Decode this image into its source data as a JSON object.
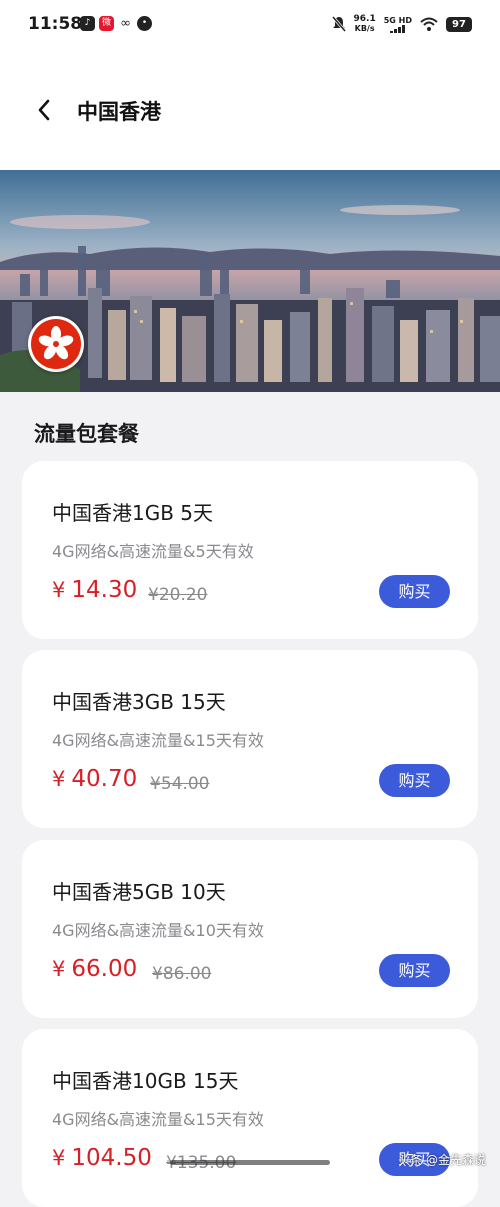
{
  "status_bar": {
    "time": "11:58",
    "app_icons": [
      "douyin-icon",
      "weibo-icon",
      "link-icon",
      "message-icon"
    ],
    "mute_icon": "bell-off-icon",
    "net_speed_value": "96.1",
    "net_speed_unit": "KB/s",
    "network_top": "5G HD",
    "wifi_icon": "wifi-icon",
    "battery": "97"
  },
  "header": {
    "title": "中国香港",
    "back_icon": "chevron-left-icon"
  },
  "banner": {
    "image_icon": "hong-kong-skyline-image",
    "flag_icon": "hong-kong-flag-icon"
  },
  "section": {
    "title": "流量包套餐"
  },
  "plans": [
    {
      "title": "中国香港1GB 5天",
      "desc": "4G网络&高速流量&5天有效",
      "currency": "¥",
      "price": "14.30",
      "old_price": "¥20.20",
      "buy_label": "购买"
    },
    {
      "title": "中国香港3GB 15天",
      "desc": "4G网络&高速流量&15天有效",
      "currency": "¥",
      "price": "40.70",
      "old_price": "¥54.00",
      "buy_label": "购买"
    },
    {
      "title": "中国香港5GB 10天",
      "desc": "4G网络&高速流量&10天有效",
      "currency": "¥",
      "price": "66.00",
      "old_price": "¥86.00",
      "buy_label": "购买"
    },
    {
      "title": "中国香港10GB 15天",
      "desc": "4G网络&高速流量&15天有效",
      "currency": "¥",
      "price": "104.50",
      "old_price": "¥135.00",
      "buy_label": "购买"
    }
  ],
  "watermark": "头条 @金先森说",
  "colors": {
    "accent": "#3b5bdb",
    "price": "#d71f26",
    "background": "#f2f2f5"
  }
}
